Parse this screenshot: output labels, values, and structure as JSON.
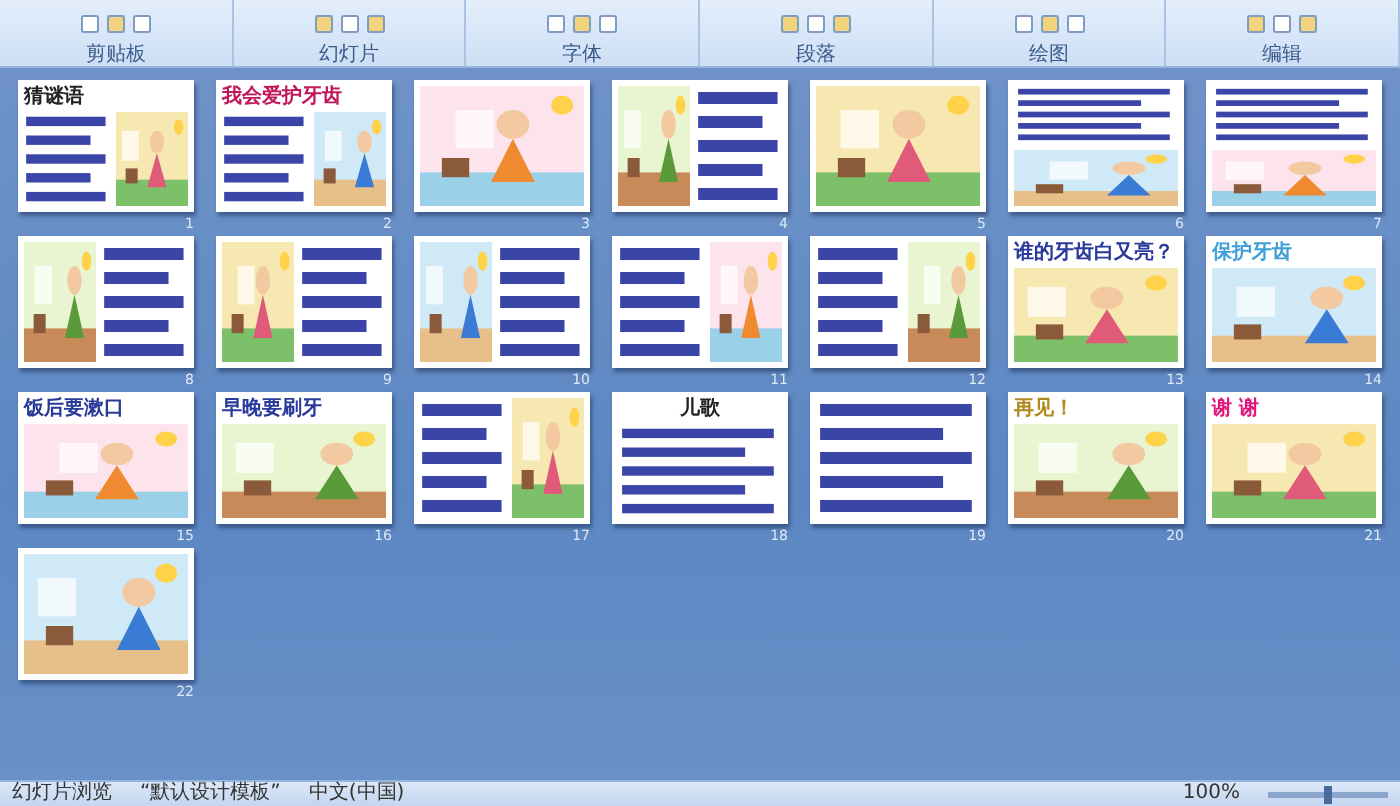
{
  "ribbon": {
    "groups": [
      {
        "label": "剪贴板"
      },
      {
        "label": "幻灯片"
      },
      {
        "label": "字体"
      },
      {
        "label": "段落"
      },
      {
        "label": "绘图"
      },
      {
        "label": "编辑"
      }
    ]
  },
  "slides": [
    {
      "number": "1",
      "title": "猜谜语",
      "color": "#222222",
      "kind": "text-picture"
    },
    {
      "number": "2",
      "title": "我会爱护牙齿",
      "color": "#c0185a",
      "kind": "text-picture"
    },
    {
      "number": "3",
      "kind": "picture"
    },
    {
      "number": "4",
      "kind": "picture-text"
    },
    {
      "number": "5",
      "kind": "picture"
    },
    {
      "number": "6",
      "kind": "text-over-picture"
    },
    {
      "number": "7",
      "kind": "text-over-picture"
    },
    {
      "number": "8",
      "kind": "picture-text"
    },
    {
      "number": "9",
      "kind": "picture-text"
    },
    {
      "number": "10",
      "kind": "picture-text"
    },
    {
      "number": "11",
      "kind": "text-picture"
    },
    {
      "number": "12",
      "kind": "text-picture"
    },
    {
      "number": "13",
      "title": "谁的牙齿白又亮？",
      "color": "#2a3a9a",
      "kind": "picture"
    },
    {
      "number": "14",
      "title": "保护牙齿",
      "color": "#3fa0d8",
      "kind": "picture"
    },
    {
      "number": "15",
      "title": "饭后要漱口",
      "color": "#2a3a9a",
      "kind": "picture"
    },
    {
      "number": "16",
      "title": "早晚要刷牙",
      "color": "#2a3a9a",
      "kind": "picture"
    },
    {
      "number": "17",
      "kind": "text-picture"
    },
    {
      "number": "18",
      "title": "儿歌",
      "color": "#222222",
      "kind": "text"
    },
    {
      "number": "19",
      "kind": "text"
    },
    {
      "number": "20",
      "title": "再见！",
      "color": "#b08a20",
      "kind": "picture"
    },
    {
      "number": "21",
      "title": "谢 谢",
      "color": "#e0157a",
      "kind": "picture"
    },
    {
      "number": "22",
      "kind": "picture"
    }
  ],
  "status_bar": {
    "items": [
      "幻灯片浏览",
      "“默认设计模板”",
      "中文(中国)"
    ],
    "zoom": "100%",
    "zoom_slider": {
      "level": 0.5
    }
  }
}
